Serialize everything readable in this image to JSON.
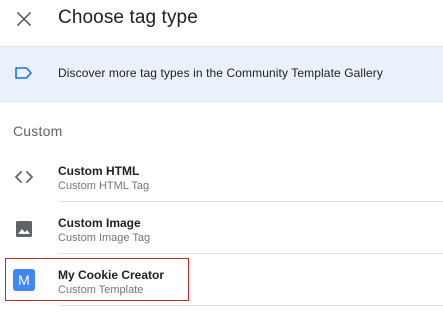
{
  "header": {
    "title": "Choose tag type",
    "close_icon": "close-icon"
  },
  "banner": {
    "icon": "label-outline-icon",
    "text": "Discover more tag types in the Community Template Gallery",
    "icon_color": "#1a73e8",
    "background": "#eaf1fb"
  },
  "section": {
    "label": "Custom"
  },
  "tag_types": [
    {
      "name": "Custom HTML",
      "description": "Custom HTML Tag",
      "icon": "code-icon"
    },
    {
      "name": "Custom Image",
      "description": "Custom Image Tag",
      "icon": "image-icon"
    },
    {
      "name": "My Cookie Creator",
      "description": "Custom Template",
      "icon": "M",
      "icon_color": "#4285f4",
      "highlighted": true
    }
  ],
  "colors": {
    "highlight_border": "#c62828",
    "text_primary": "#212121",
    "text_secondary": "#757575"
  }
}
